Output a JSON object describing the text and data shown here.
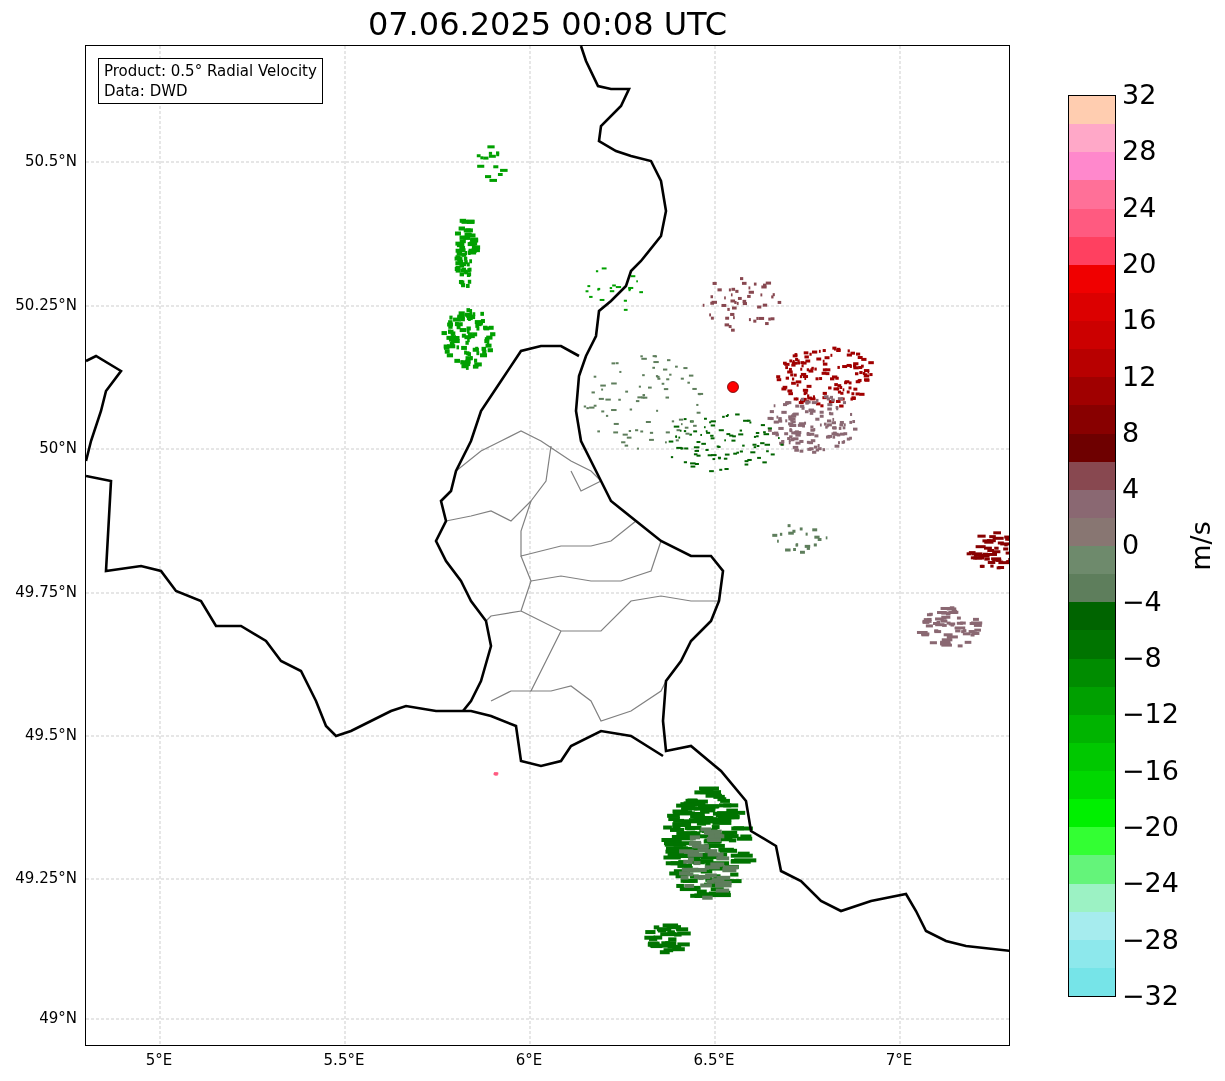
{
  "title": "07.06.2025 00:08 UTC",
  "info_box": {
    "lines": [
      "Product: 0.5° Radial Velocity",
      "Data: DWD"
    ]
  },
  "map": {
    "xtick_labels": [
      "5°E",
      "5.5°E",
      "6°E",
      "6.5°E",
      "7°E"
    ],
    "ytick_labels": [
      "50.5°N",
      "50.25°N",
      "50°N",
      "49.75°N",
      "49.5°N",
      "49.25°N",
      "49°N"
    ]
  },
  "colorbar": {
    "label": "m/s",
    "tick_labels": [
      "32",
      "28",
      "24",
      "20",
      "16",
      "12",
      "8",
      "4",
      "0",
      "−4",
      "−8",
      "−12",
      "−16",
      "−20",
      "−24",
      "−28",
      "−32"
    ],
    "segments": [
      {
        "color": "#ffcdb0"
      },
      {
        "color": "#ffa8c8"
      },
      {
        "color": "#ff88cc"
      },
      {
        "color": "#ff7098"
      },
      {
        "color": "#ff5a80"
      },
      {
        "color": "#ff4060"
      },
      {
        "color": "#f00000"
      },
      {
        "color": "#dc0000"
      },
      {
        "color": "#cc0000"
      },
      {
        "color": "#b80000"
      },
      {
        "color": "#a00000"
      },
      {
        "color": "#880000"
      },
      {
        "color": "#6e0000"
      },
      {
        "color": "#884850"
      },
      {
        "color": "#8a6872"
      },
      {
        "color": "#887672"
      },
      {
        "color": "#6e8a6c"
      },
      {
        "color": "#5e7e5c"
      },
      {
        "color": "#006400"
      },
      {
        "color": "#007400"
      },
      {
        "color": "#008c00"
      },
      {
        "color": "#00a000"
      },
      {
        "color": "#00b400"
      },
      {
        "color": "#00c800"
      },
      {
        "color": "#00d800"
      },
      {
        "color": "#00f000"
      },
      {
        "color": "#33ff33"
      },
      {
        "color": "#64f47a"
      },
      {
        "color": "#9cf2c4"
      },
      {
        "color": "#a6ecee"
      },
      {
        "color": "#8de8ec"
      },
      {
        "color": "#76e4e8"
      }
    ]
  }
}
